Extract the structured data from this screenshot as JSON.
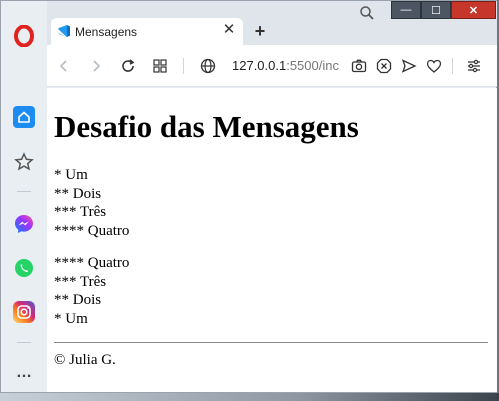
{
  "browser": {
    "tab_title": "Mensagens",
    "tab_close": "✕",
    "new_tab": "+",
    "url_host": "127.0.0.1",
    "url_rest": ":5500/inc",
    "window_controls": {
      "minimize": "—",
      "maximize": "☐",
      "close": "✕"
    }
  },
  "sidebar": {
    "items": [
      {
        "icon": "opera-logo-icon",
        "color": "#e0231f"
      },
      {
        "icon": "home-icon",
        "color": "#1d8cf0"
      },
      {
        "icon": "star-icon",
        "color": "#555555"
      },
      {
        "icon": "messenger-icon",
        "color": "#8a3ffc"
      },
      {
        "icon": "whatsapp-icon",
        "color": "#25d366"
      },
      {
        "icon": "instagram-icon",
        "color": "#d62976"
      },
      {
        "icon": "more-icon",
        "color": "#444444"
      }
    ],
    "more_label": "…"
  },
  "page": {
    "heading": "Desafio das Mensagens",
    "list_forward": [
      "* Um",
      "** Dois",
      "*** Três",
      "**** Quatro"
    ],
    "list_reverse": [
      "**** Quatro",
      "*** Três",
      "** Dois",
      "* Um"
    ],
    "footer": "© Julia G."
  }
}
